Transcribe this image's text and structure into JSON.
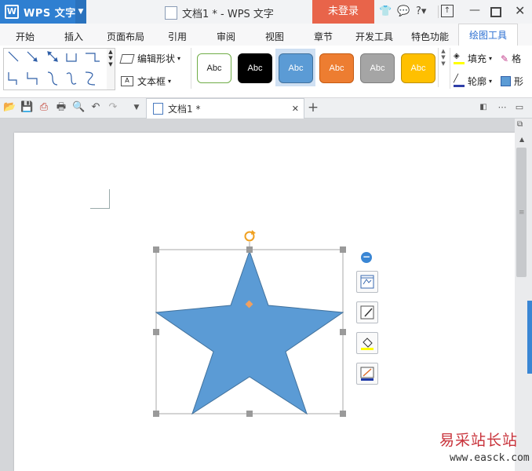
{
  "app": {
    "name": "WPS 文字",
    "window_title": "文档1 * - WPS 文字",
    "login_label": "未登录"
  },
  "ribbon_tabs": [
    "开始",
    "插入",
    "页面布局",
    "引用",
    "审阅",
    "视图",
    "章节",
    "开发工具",
    "特色功能",
    "绘图工具"
  ],
  "active_tab": "绘图工具",
  "ribbon": {
    "edit_shape_label": "编辑形状",
    "textbox_label": "文本框",
    "style_label": "Abc",
    "fill_label": "填充",
    "outline_label": "轮廓",
    "cut_label_1": "格",
    "cut_label_2": "形"
  },
  "doc_tab": {
    "label": "文档1 *"
  },
  "colors": {
    "accent": "#2f7fd1",
    "star_fill": "#5b9bd5",
    "login_bg": "#e8644a",
    "style_orange": "#ed7d31",
    "style_gray": "#a5a5a5",
    "style_gold": "#ffc000"
  },
  "watermark": {
    "text": "易采站长站",
    "url": "www.easck.com"
  }
}
